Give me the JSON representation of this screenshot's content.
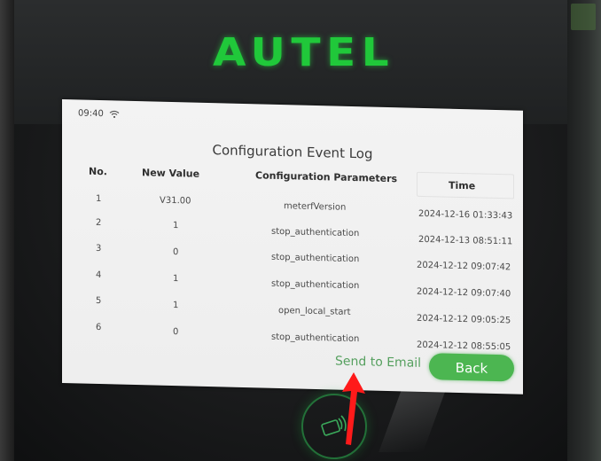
{
  "device": {
    "brand": "AUTEL",
    "brand_color": "#20c83a"
  },
  "status_bar": {
    "time": "09:40",
    "wifi_icon": "wifi-icon"
  },
  "screen": {
    "title": "Configuration Event Log",
    "columns": [
      "No.",
      "New Value",
      "Configuration Parameters",
      "Time"
    ],
    "rows": [
      {
        "no": "1",
        "value": "V31.00",
        "param": "meterfVersion",
        "time": "2024-12-16 01:33:43"
      },
      {
        "no": "2",
        "value": "1",
        "param": "stop_authentication",
        "time": "2024-12-13 08:51:11"
      },
      {
        "no": "3",
        "value": "0",
        "param": "stop_authentication",
        "time": "2024-12-12 09:07:42"
      },
      {
        "no": "4",
        "value": "1",
        "param": "stop_authentication",
        "time": "2024-12-12 09:07:40"
      },
      {
        "no": "5",
        "value": "1",
        "param": "open_local_start",
        "time": "2024-12-12 09:05:25"
      },
      {
        "no": "6",
        "value": "0",
        "param": "stop_authentication",
        "time": "2024-12-12 08:55:05"
      }
    ],
    "send_email_label": "Send to Email",
    "back_label": "Back",
    "accent_color": "#4cb651"
  },
  "annotation": {
    "arrow_icon": "red-arrow-icon",
    "arrow_color": "#ff1a1a"
  }
}
